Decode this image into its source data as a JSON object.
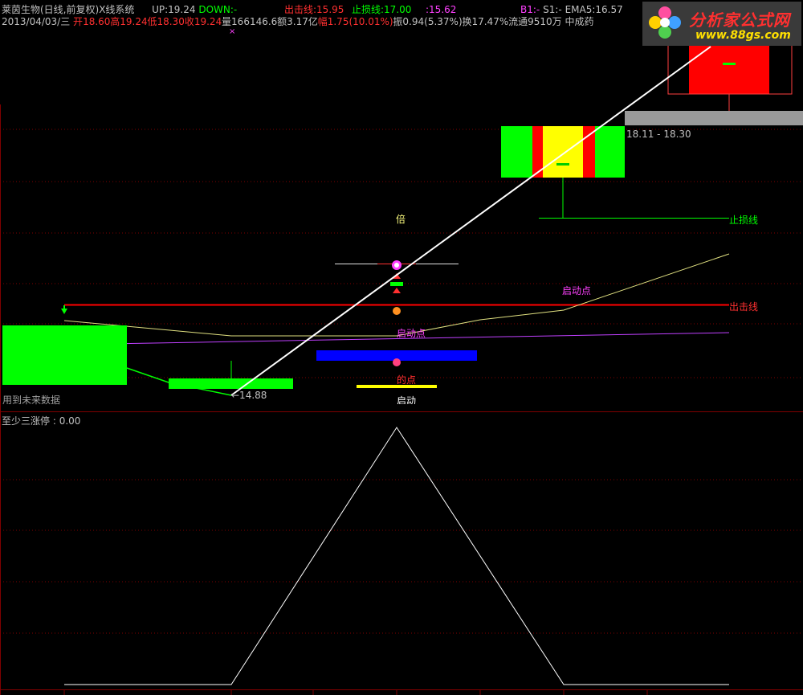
{
  "header": {
    "title": "莱茵生物(日线,前复权)",
    "system": "X线系统",
    "up_label": "UP:",
    "up_value": "19.24",
    "down_label": "DOWN:",
    "down_value": "-",
    "chuji_label": "出击线:",
    "chuji_value": "15.95",
    "zhisun_label": "止损线:",
    "zhisun_value": "17.00",
    "extra_value": ":15.62",
    "b1_label": "B1:",
    "b1_value": "-",
    "s1_label": "S1:",
    "s1_value": "-",
    "ema5_label": "EMA5:",
    "ema5_value": "16.57"
  },
  "quote": {
    "date": "2013/04/03/三",
    "open_label": "开",
    "open": "18.60",
    "high_label": "高",
    "high": "19.24",
    "low_label": "低",
    "low": "18.30",
    "close_label": "收",
    "close": "19.24",
    "volume_label": "量",
    "volume": "166146.6",
    "amount_label": "额",
    "amount": "3.17亿",
    "change_label": "幅",
    "change": "1.75(10.01%)",
    "amplitude_label": "振",
    "amplitude": "0.94(5.37%)",
    "turnover_label": "换",
    "turnover": "17.47%",
    "float_label": "流通",
    "float": "9510万",
    "sector": "中成药"
  },
  "annotations": {
    "range_label": "18.11 - 18.30",
    "stop_line_label": "止损线",
    "attack_line_label": "出击线",
    "start_point_1": "启动点",
    "start_point_2": "启动点",
    "bei": "倍",
    "de_dian": "的点",
    "qi_dong": "启动",
    "low_price": "←14.88",
    "future_data": "用到未来数据",
    "cross_mark": "×"
  },
  "indicator": {
    "name": "至少三涨停",
    "value": "0.00"
  },
  "logo": {
    "name": "分析家公式网",
    "url_text": "www.88gs.com"
  },
  "colors": {
    "background": "#000000",
    "up_red": "#ff3030",
    "green": "#00ff00",
    "yellow": "#ffff00",
    "magenta": "#ff40ff",
    "blue": "#0000ff",
    "axis": "#800000"
  }
}
